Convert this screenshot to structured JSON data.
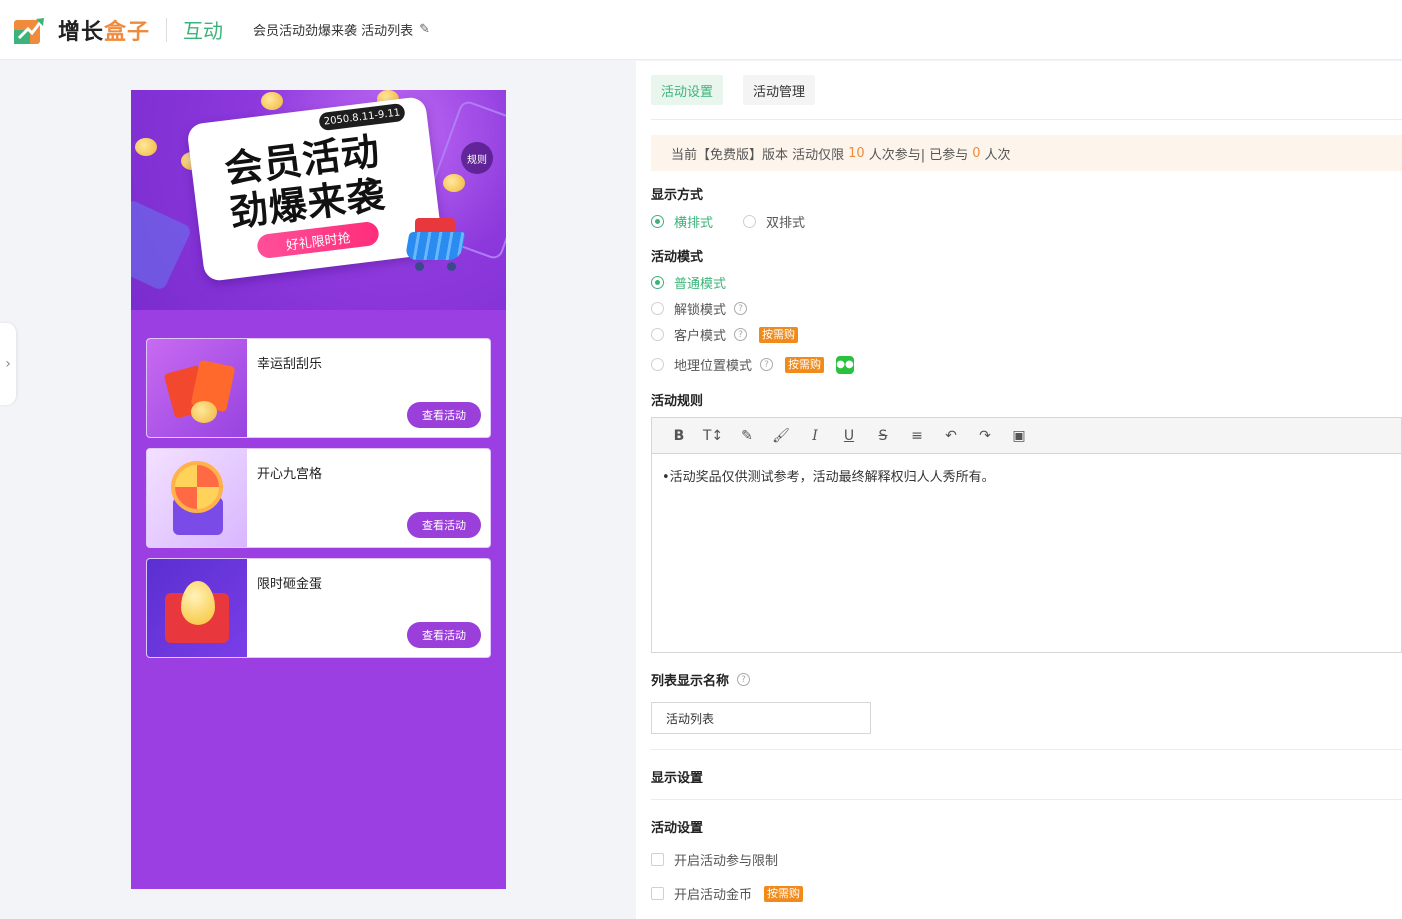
{
  "header": {
    "brand_part1": "增长",
    "brand_part2": "盒子",
    "module": "互动",
    "page_title": "会员活动劲爆来袭 活动列表"
  },
  "preview": {
    "banner": {
      "date": "2050.8.11-9.11",
      "title_line1": "会员活动",
      "title_line2": "劲爆来袭",
      "pill": "好礼限时抢",
      "rules": "规则"
    },
    "activities": [
      {
        "name": "幸运刮刮乐",
        "button": "查看活动"
      },
      {
        "name": "开心九宫格",
        "button": "查看活动"
      },
      {
        "name": "限时砸金蛋",
        "button": "查看活动"
      }
    ]
  },
  "settings": {
    "tabs": [
      {
        "label": "活动设置",
        "active": true
      },
      {
        "label": "活动管理",
        "active": false
      }
    ],
    "notice": {
      "prefix": "当前【免费版】版本 活动仅限",
      "limit": "10",
      "middle": "人次参与| 已参与",
      "used": "0",
      "suffix": "人次"
    },
    "display_mode": {
      "label": "显示方式",
      "options": [
        {
          "label": "横排式",
          "checked": true
        },
        {
          "label": "双排式",
          "checked": false
        }
      ]
    },
    "activity_mode": {
      "label": "活动模式",
      "options": [
        {
          "label": "普通模式",
          "checked": true
        },
        {
          "label": "解锁模式",
          "checked": false
        },
        {
          "label": "客户模式",
          "checked": false,
          "tag": "按需购"
        },
        {
          "label": "地理位置模式",
          "checked": false,
          "tag": "按需购"
        }
      ]
    },
    "rules": {
      "label": "活动规则",
      "content": "•活动奖品仅供测试参考，活动最终解释权归人人秀所有。"
    },
    "list_name": {
      "label": "列表显示名称",
      "value": "活动列表"
    },
    "display_settings_label": "显示设置",
    "activity_settings": {
      "label": "活动设置",
      "options": [
        {
          "label": "开启活动参与限制",
          "checked": false
        },
        {
          "label": "开启活动金币",
          "checked": false,
          "tag": "按需购"
        }
      ]
    }
  },
  "colors": {
    "accent": "#3db37a",
    "brand_orange": "#f08a3c",
    "preview_purple": "#9b3fe3",
    "tag_orange": "#f08a1a"
  }
}
